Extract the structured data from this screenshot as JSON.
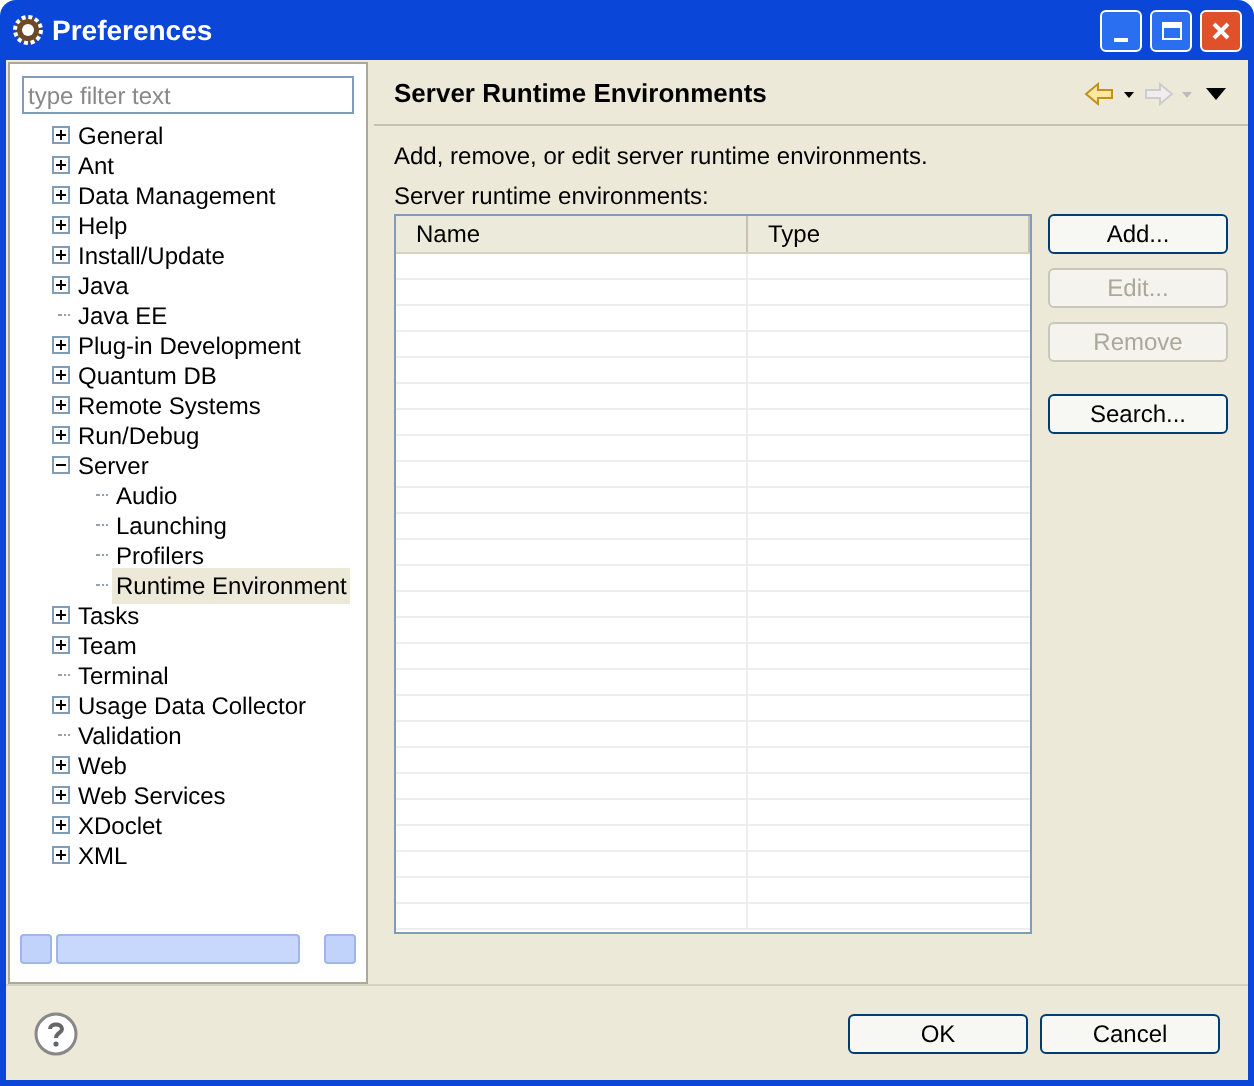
{
  "window": {
    "title": "Preferences"
  },
  "filter": {
    "placeholder": "type filter text"
  },
  "tree": [
    {
      "label": "General",
      "expanded": false,
      "selected": false
    },
    {
      "label": "Ant",
      "expanded": false,
      "selected": false
    },
    {
      "label": "Data Management",
      "expanded": false,
      "selected": false
    },
    {
      "label": "Help",
      "expanded": false,
      "selected": false
    },
    {
      "label": "Install/Update",
      "expanded": false,
      "selected": false
    },
    {
      "label": "Java",
      "expanded": false,
      "selected": false
    },
    {
      "label": "Java EE",
      "selected": false
    },
    {
      "label": "Plug-in Development",
      "expanded": false,
      "selected": false
    },
    {
      "label": "Quantum DB",
      "expanded": false,
      "selected": false
    },
    {
      "label": "Remote Systems",
      "expanded": false,
      "selected": false
    },
    {
      "label": "Run/Debug",
      "expanded": false,
      "selected": false
    },
    {
      "label": "Server",
      "expanded": true,
      "selected": false,
      "children": [
        {
          "label": "Audio",
          "selected": false
        },
        {
          "label": "Launching",
          "selected": false
        },
        {
          "label": "Profilers",
          "selected": false
        },
        {
          "label": "Runtime Environment",
          "selected": true
        }
      ]
    },
    {
      "label": "Tasks",
      "expanded": false,
      "selected": false
    },
    {
      "label": "Team",
      "expanded": false,
      "selected": false
    },
    {
      "label": "Terminal",
      "selected": false
    },
    {
      "label": "Usage Data Collector",
      "expanded": false,
      "selected": false
    },
    {
      "label": "Validation",
      "selected": false
    },
    {
      "label": "Web",
      "expanded": false,
      "selected": false
    },
    {
      "label": "Web Services",
      "expanded": false,
      "selected": false
    },
    {
      "label": "XDoclet",
      "expanded": false,
      "selected": false
    },
    {
      "label": "XML",
      "expanded": false,
      "selected": false
    }
  ],
  "page": {
    "title": "Server Runtime Environments",
    "description": "Add, remove, or edit server runtime environments.",
    "list_label": "Server runtime environments:"
  },
  "table": {
    "columns": [
      "Name",
      "Type"
    ]
  },
  "side_buttons": [
    {
      "label": "Add...",
      "disabled": false
    },
    {
      "label": "Edit...",
      "disabled": true
    },
    {
      "label": "Remove",
      "disabled": true
    },
    {
      "label": "Search...",
      "disabled": false
    }
  ],
  "buttons": [
    "OK",
    "Cancel"
  ]
}
